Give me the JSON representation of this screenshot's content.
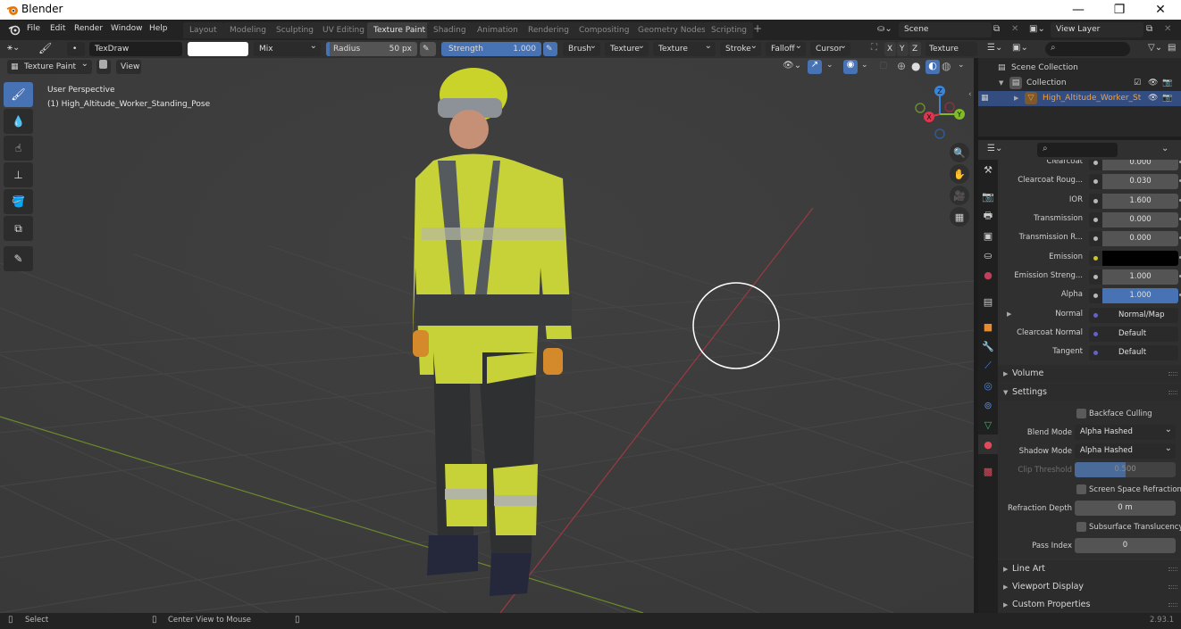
{
  "window": {
    "title": "Blender",
    "minimize": "—",
    "maximize": "❐",
    "close": "✕"
  },
  "menu": [
    "File",
    "Edit",
    "Render",
    "Window",
    "Help"
  ],
  "workspaces": [
    {
      "label": "Layout",
      "active": false
    },
    {
      "label": "Modeling",
      "active": false
    },
    {
      "label": "Sculpting",
      "active": false
    },
    {
      "label": "UV Editing",
      "active": false
    },
    {
      "label": "Texture Paint",
      "active": true
    },
    {
      "label": "Shading",
      "active": false
    },
    {
      "label": "Animation",
      "active": false
    },
    {
      "label": "Rendering",
      "active": false
    },
    {
      "label": "Compositing",
      "active": false
    },
    {
      "label": "Geometry Nodes",
      "active": false
    },
    {
      "label": "Scripting",
      "active": false
    }
  ],
  "add_workspace": "+",
  "scene": {
    "name": "Scene",
    "view_layer": "View Layer"
  },
  "tool_header": {
    "brush_name": "TexDraw",
    "color_hex": "#ffffff",
    "blend": "Mix",
    "radius_label": "Radius",
    "radius_value": "50 px",
    "strength_label": "Strength",
    "strength_value": "1.000",
    "menus": [
      "Brush",
      "Texture",
      "Texture Mask",
      "Stroke",
      "Falloff",
      "Cursor"
    ],
    "axes": [
      "X",
      "Y",
      "Z"
    ],
    "texture_slots": "Texture Slots"
  },
  "viewport": {
    "mode": "Texture Paint",
    "view_menu": "View",
    "perspective": "User Perspective",
    "object_label": "(1) High_Altitude_Worker_Standing_Pose",
    "gizmo": {
      "x": "X",
      "y": "Y",
      "z": "Z"
    }
  },
  "outliner": {
    "root": "Scene Collection",
    "collection": "Collection",
    "object": "High_Altitude_Worker_St"
  },
  "properties": {
    "rows": [
      {
        "label": "Clearcoat",
        "value": "0.000",
        "socket": "#b8b8b8"
      },
      {
        "label": "Clearcoat Roug...",
        "value": "0.030",
        "socket": "#b8b8b8"
      },
      {
        "label": "IOR",
        "value": "1.600",
        "socket": "#b8b8b8"
      },
      {
        "label": "Transmission",
        "value": "0.000",
        "socket": "#b8b8b8"
      },
      {
        "label": "Transmission R...",
        "value": "0.000",
        "socket": "#b8b8b8"
      },
      {
        "label": "Emission",
        "value": "",
        "socket": "#c7c729",
        "color": "#000000"
      },
      {
        "label": "Emission Streng...",
        "value": "1.000",
        "socket": "#b8b8b8"
      },
      {
        "label": "Alpha",
        "value": "1.000",
        "socket": "#b8b8b8",
        "highlight": true
      },
      {
        "label": "Normal",
        "value": "Normal/Map",
        "socket": "#6363c7",
        "link": true
      },
      {
        "label": "Clearcoat Normal",
        "value": "Default",
        "socket": "#6363c7",
        "link": true
      },
      {
        "label": "Tangent",
        "value": "Default",
        "socket": "#6363c7",
        "link": true
      }
    ],
    "panels": {
      "volume": "Volume",
      "settings": "Settings",
      "line_art": "Line Art",
      "viewport_display": "Viewport Display",
      "custom_properties": "Custom Properties"
    },
    "settings": {
      "backface_culling": {
        "label": "Backface Culling",
        "checked": false
      },
      "blend_mode": {
        "label": "Blend Mode",
        "value": "Alpha Hashed"
      },
      "shadow_mode": {
        "label": "Shadow Mode",
        "value": "Alpha Hashed"
      },
      "clip_threshold": {
        "label": "Clip Threshold",
        "value": "0.500",
        "fraction": 0.5
      },
      "screen_space_refraction": {
        "label": "Screen Space Refraction",
        "checked": false
      },
      "refraction_depth": {
        "label": "Refraction Depth",
        "value": "0 m"
      },
      "subsurface_translucency": {
        "label": "Subsurface Translucency",
        "checked": false
      },
      "pass_index": {
        "label": "Pass Index",
        "value": "0"
      }
    }
  },
  "statusbar": {
    "select": "Select",
    "center_view": "Center View to Mouse",
    "version": "2.93.1"
  }
}
